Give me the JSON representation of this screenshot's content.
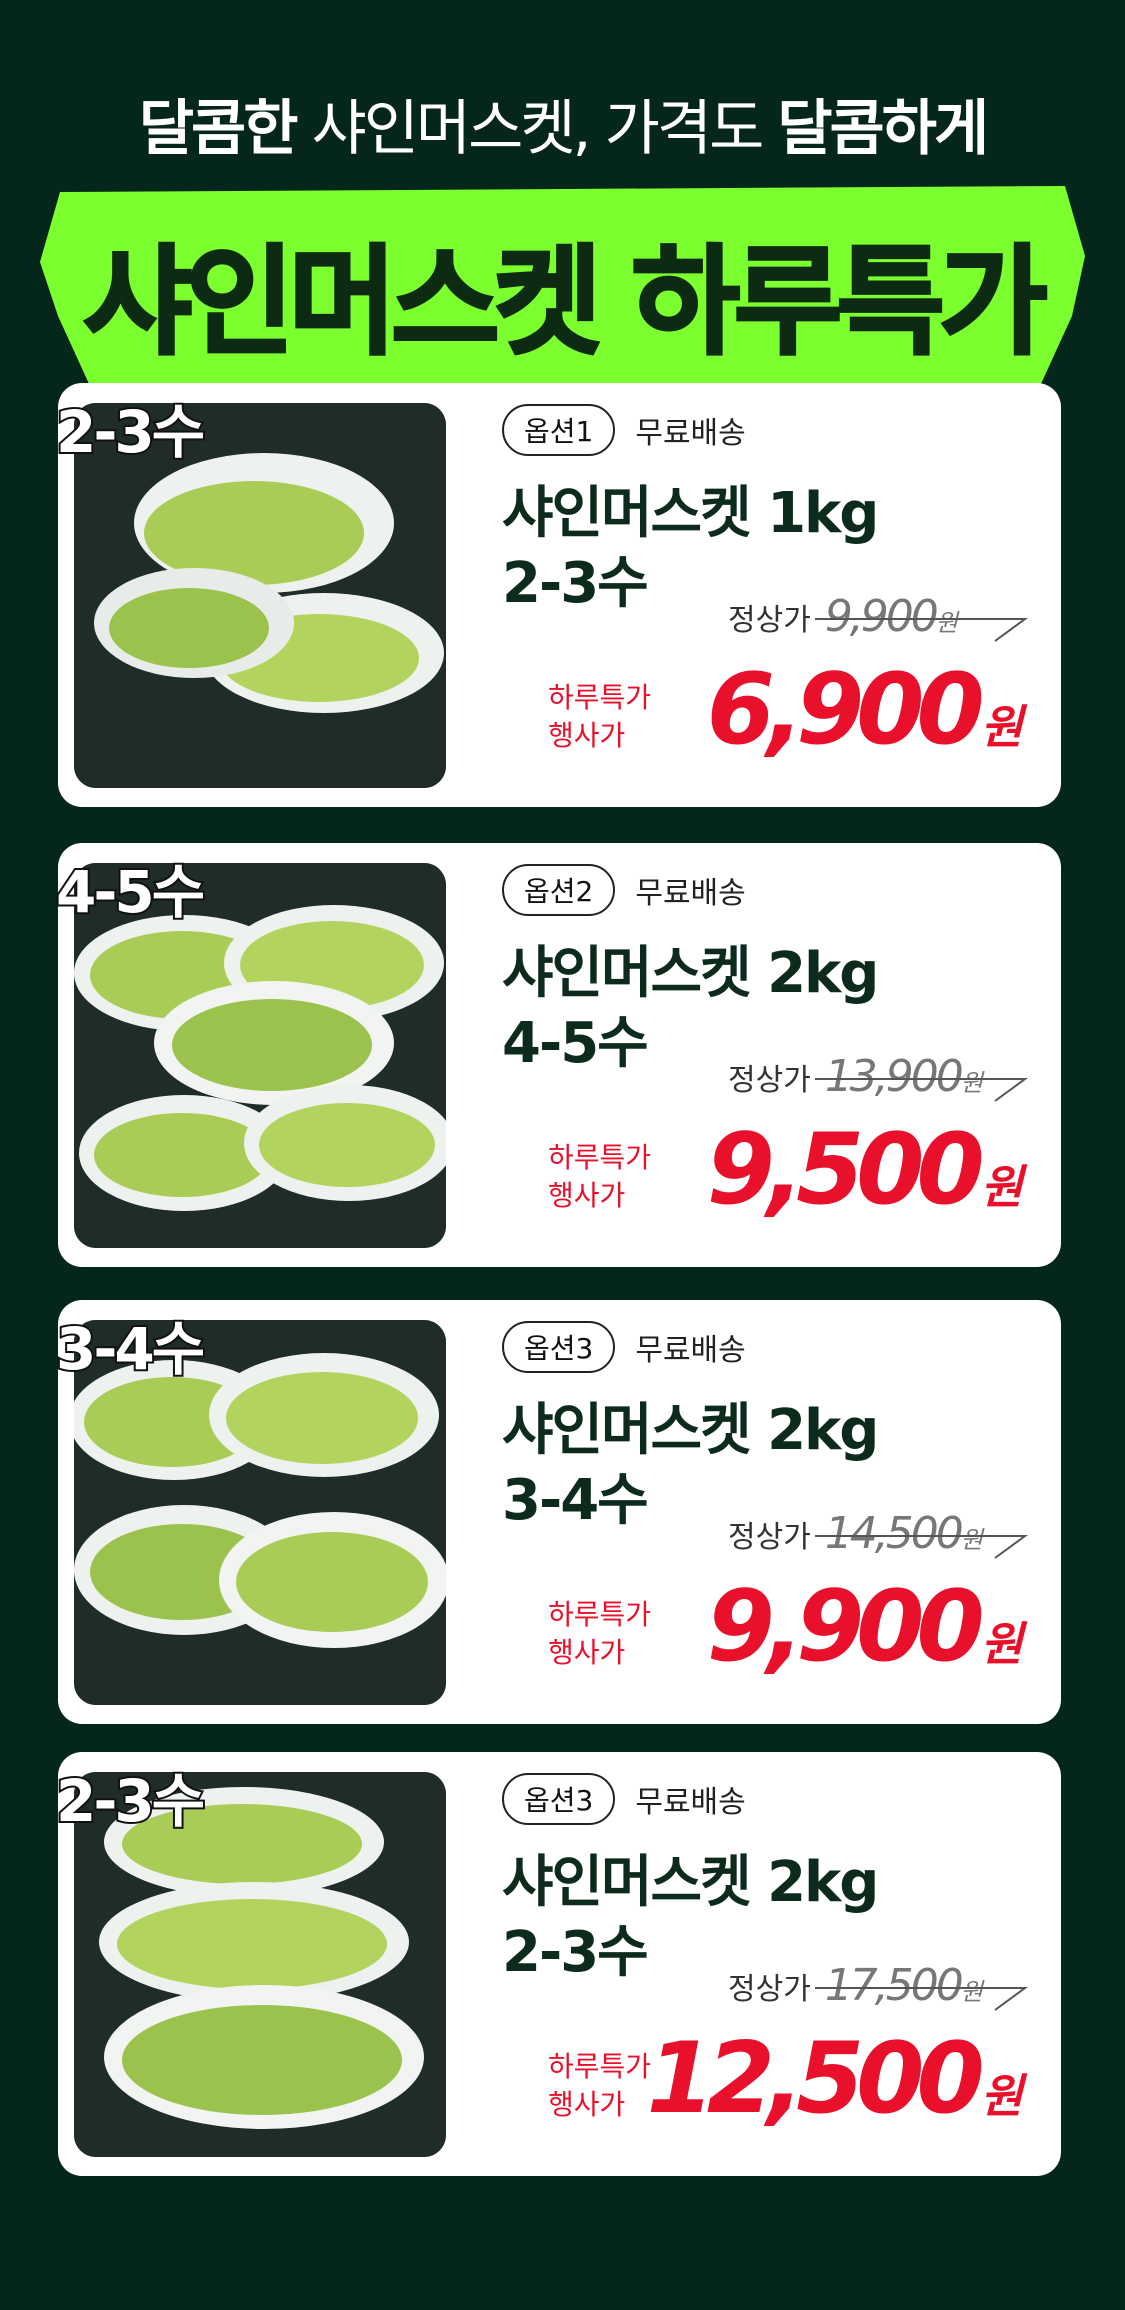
{
  "header": {
    "tagline_bold1": "달콤한",
    "tagline_mid": " 샤인머스켓, 가격도 ",
    "tagline_bold2": "달콤하게",
    "banner_title": "샤인머스켓 하루특가",
    "banner_color": "#7cff2e"
  },
  "products": [
    {
      "size_tag": "2-3수",
      "option": "옵션1",
      "shipping": "무료배송",
      "name_line1": "샤인머스켓 1kg",
      "name_line2": "2-3수",
      "orig_label": "정상가",
      "orig_price": "9,900",
      "orig_unit": "원",
      "sale_label_1": "하루특가",
      "sale_label_2": "행사가",
      "sale_price": "6,900",
      "sale_unit": "원"
    },
    {
      "size_tag": "4-5수",
      "option": "옵션2",
      "shipping": "무료배송",
      "name_line1": "샤인머스켓 2kg",
      "name_line2": "4-5수",
      "orig_label": "정상가",
      "orig_price": "13,900",
      "orig_unit": "원",
      "sale_label_1": "하루특가",
      "sale_label_2": "행사가",
      "sale_price": "9,500",
      "sale_unit": "원"
    },
    {
      "size_tag": "3-4수",
      "option": "옵션3",
      "shipping": "무료배송",
      "name_line1": "샤인머스켓 2kg",
      "name_line2": "3-4수",
      "orig_label": "정상가",
      "orig_price": "14,500",
      "orig_unit": "원",
      "sale_label_1": "하루특가",
      "sale_label_2": "행사가",
      "sale_price": "9,900",
      "sale_unit": "원"
    },
    {
      "size_tag": "2-3수",
      "option": "옵션3",
      "shipping": "무료배송",
      "name_line1": "샤인머스켓 2kg",
      "name_line2": "2-3수",
      "orig_label": "정상가",
      "orig_price": "17,500",
      "orig_unit": "원",
      "sale_label_1": "하루특가",
      "sale_label_2": "행사가",
      "sale_price": "12,500",
      "sale_unit": "원"
    }
  ],
  "colors": {
    "background": "#04261b",
    "accent_green": "#7cff2e",
    "sale_red": "#e8102a"
  }
}
